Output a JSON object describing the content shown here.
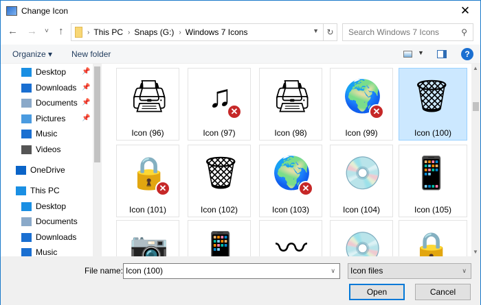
{
  "window": {
    "title": "Change Icon",
    "close": "✕"
  },
  "nav": {
    "back": "←",
    "forward": "→",
    "recent": "˅",
    "up": "↑",
    "breadcrumb": [
      "This PC",
      "Snaps (G:)",
      "Windows 7 Icons"
    ],
    "separator": "›",
    "refresh": "↻",
    "search_placeholder": "Search Windows 7 Icons"
  },
  "toolbar": {
    "organize": "Organize ▾",
    "new_folder": "New folder",
    "help": "?"
  },
  "sidebar": {
    "items": [
      {
        "label": "Desktop",
        "pinned": true,
        "color": "#1a8fe3"
      },
      {
        "label": "Downloads",
        "pinned": true,
        "color": "#1a6fd1"
      },
      {
        "label": "Documents",
        "pinned": true,
        "color": "#8aa9c9"
      },
      {
        "label": "Pictures",
        "pinned": true,
        "color": "#4a9be0"
      },
      {
        "label": "Music",
        "pinned": false,
        "color": "#1a6fd1"
      },
      {
        "label": "Videos",
        "pinned": false,
        "color": "#555555"
      },
      {
        "label": "OneDrive",
        "pinned": false,
        "color": "#0a64c8"
      },
      {
        "label": "This PC",
        "pinned": false,
        "color": "#1a8fe3"
      },
      {
        "label": "Desktop",
        "pinned": false,
        "color": "#1a8fe3"
      },
      {
        "label": "Documents",
        "pinned": false,
        "color": "#8aa9c9"
      },
      {
        "label": "Downloads",
        "pinned": false,
        "color": "#1a6fd1"
      },
      {
        "label": "Music",
        "pinned": false,
        "color": "#1a6fd1"
      }
    ]
  },
  "icons": [
    {
      "label": "Icon (96)",
      "glyph": "🖨",
      "error": false
    },
    {
      "label": "Icon (97)",
      "glyph": "♫",
      "error": true
    },
    {
      "label": "Icon (98)",
      "glyph": "🖨",
      "error": false
    },
    {
      "label": "Icon (99)",
      "glyph": "🌍",
      "error": true
    },
    {
      "label": "Icon (100)",
      "glyph": "🗑",
      "error": false,
      "selected": true
    },
    {
      "label": "Icon (101)",
      "glyph": "🔒",
      "error": true
    },
    {
      "label": "Icon (102)",
      "glyph": "🗑",
      "error": false
    },
    {
      "label": "Icon (103)",
      "glyph": "🌍",
      "error": true
    },
    {
      "label": "Icon (104)",
      "glyph": "💿",
      "error": false
    },
    {
      "label": "Icon (105)",
      "glyph": "📱",
      "error": false
    },
    {
      "label": "",
      "glyph": "📷",
      "error": false
    },
    {
      "label": "",
      "glyph": "📱",
      "error": false
    },
    {
      "label": "",
      "glyph": "〰",
      "error": false
    },
    {
      "label": "",
      "glyph": "💿",
      "error": false
    },
    {
      "label": "",
      "glyph": "🔒",
      "error": false
    }
  ],
  "footer": {
    "file_name_label": "File name:",
    "file_name_value": "Icon (100)",
    "file_type": "Icon files",
    "open": "Open",
    "cancel": "Cancel"
  }
}
